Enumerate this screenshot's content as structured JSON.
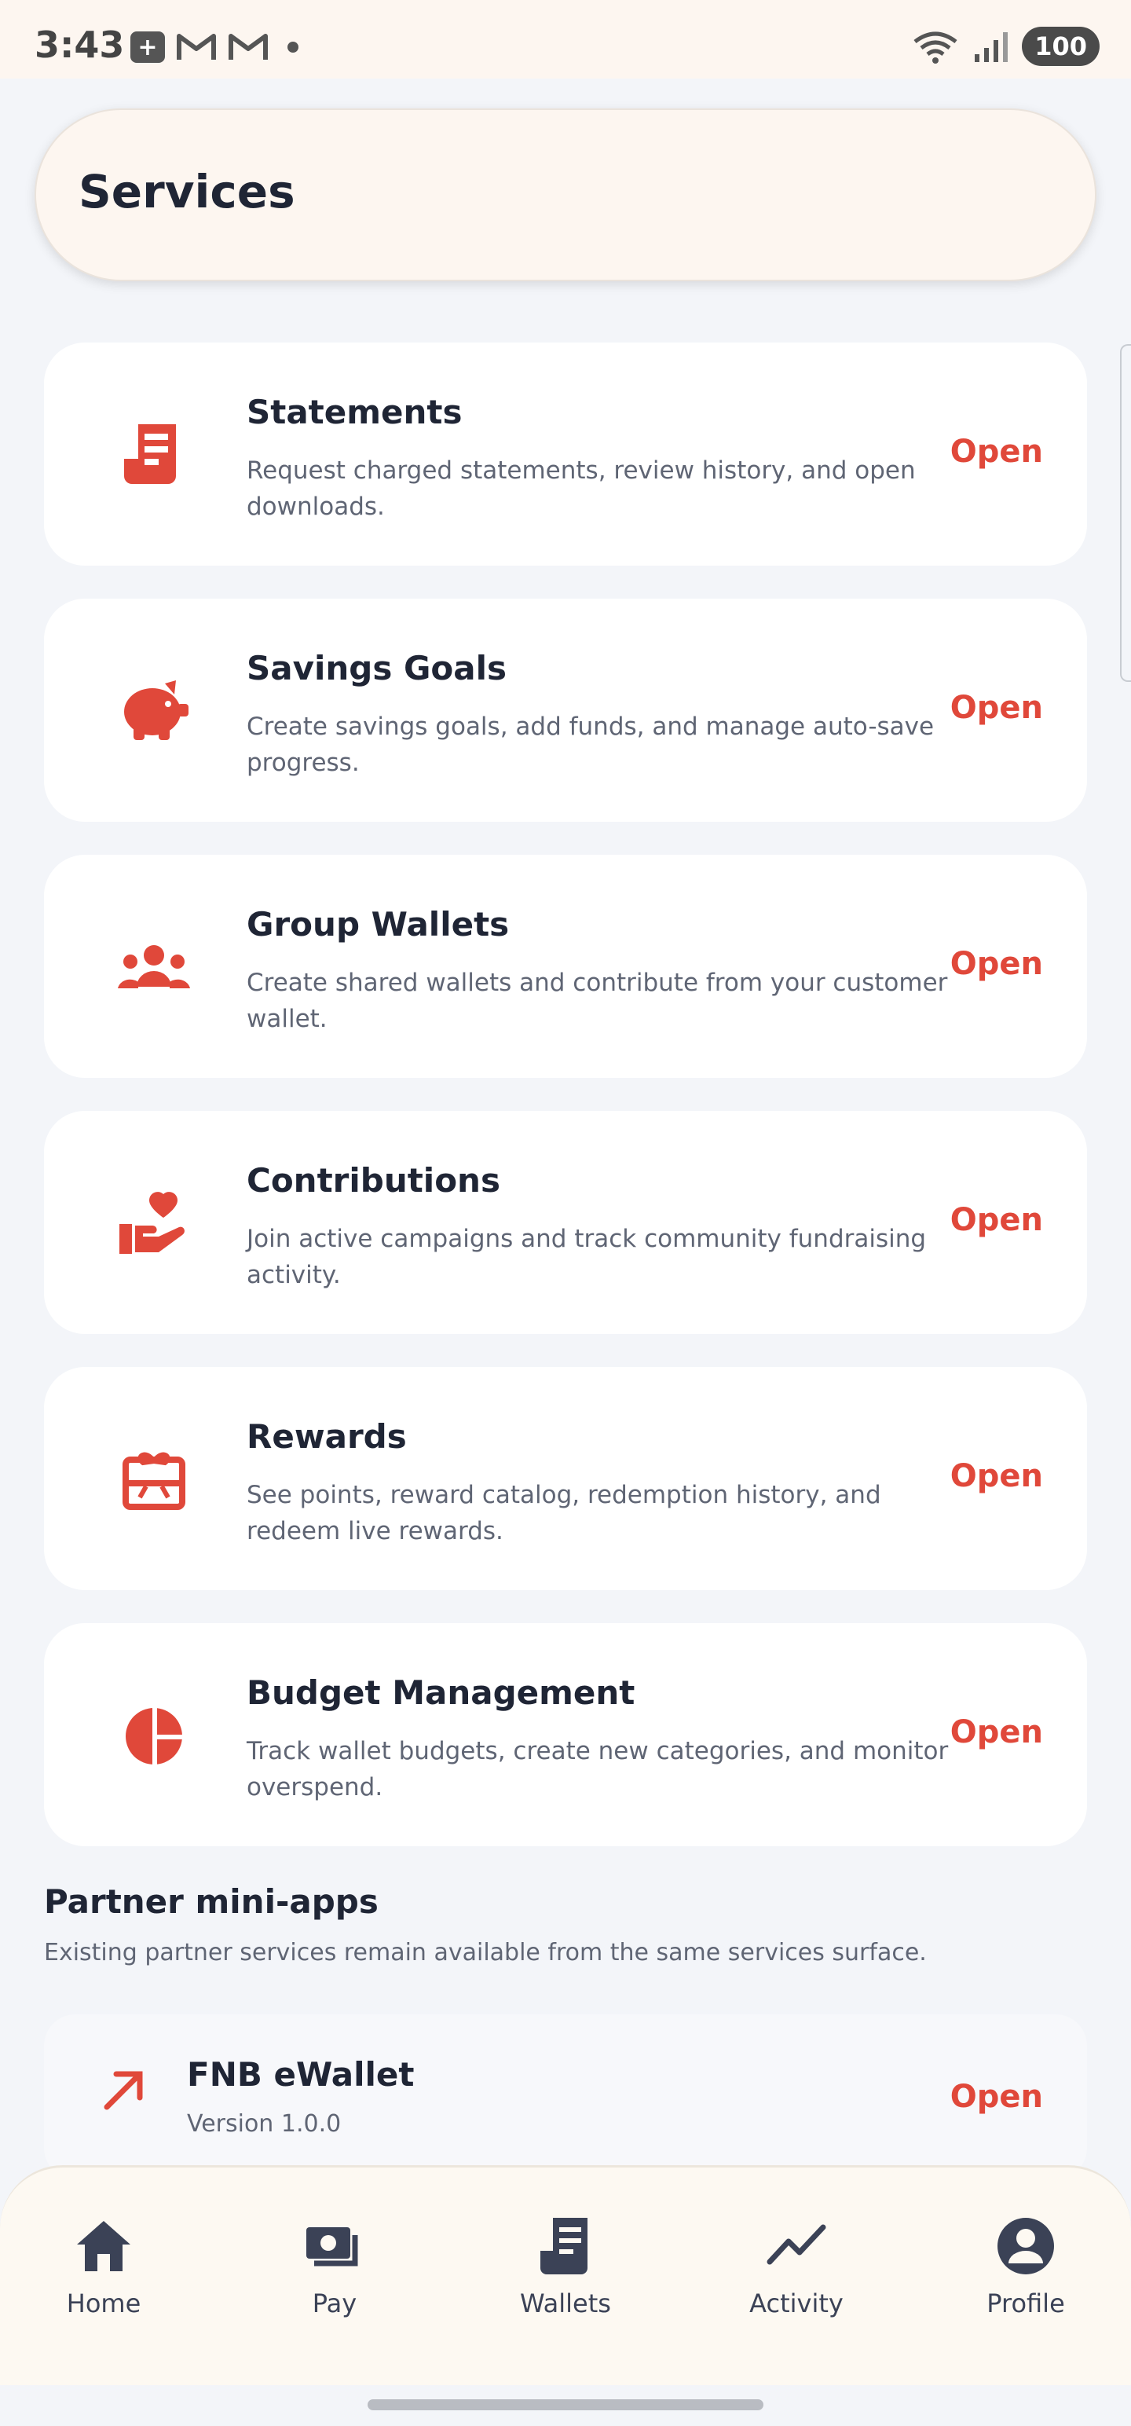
{
  "status_bar": {
    "time": "3:43",
    "battery": "100",
    "icons": [
      "plus-chip-icon",
      "gmail-icon",
      "gmail-icon",
      "dot-icon",
      "wifi-icon",
      "signal-icon"
    ]
  },
  "header": {
    "title": "Services"
  },
  "services": [
    {
      "title": "Statements",
      "desc": "Request charged statements, review history, and open downloads.",
      "action": "Open",
      "icon": "receipt-icon"
    },
    {
      "title": "Savings Goals",
      "desc": "Create savings goals, add funds, and manage auto-save progress.",
      "action": "Open",
      "icon": "piggy-bank-icon"
    },
    {
      "title": "Group Wallets",
      "desc": "Create shared wallets and contribute from your customer wallet.",
      "action": "Open",
      "icon": "group-icon"
    },
    {
      "title": "Contributions",
      "desc": "Join active campaigns and track community fundraising activity.",
      "action": "Open",
      "icon": "hand-heart-icon"
    },
    {
      "title": "Rewards",
      "desc": "See points, reward catalog, redemption history, and redeem live rewards.",
      "action": "Open",
      "icon": "gift-card-icon"
    },
    {
      "title": "Budget Management",
      "desc": "Track wallet budgets, create new categories, and monitor overspend.",
      "action": "Open",
      "icon": "pie-chart-icon"
    }
  ],
  "partner_section": {
    "title": "Partner mini-apps",
    "desc": "Existing partner services remain available from the same services surface.",
    "apps": [
      {
        "name": "FNB eWallet",
        "version": "Version 1.0.0",
        "action": "Open",
        "icon": "arrow-up-right-icon"
      }
    ]
  },
  "bottom_nav": [
    {
      "label": "Home",
      "icon": "home-icon"
    },
    {
      "label": "Pay",
      "icon": "pay-icon"
    },
    {
      "label": "Wallets",
      "icon": "receipt-icon"
    },
    {
      "label": "Activity",
      "icon": "trend-icon"
    },
    {
      "label": "Profile",
      "icon": "account-icon"
    }
  ],
  "colors": {
    "accent": "#e0483a",
    "text": "#1f2535",
    "muted": "#5f6574",
    "background": "#f3f5f9"
  }
}
